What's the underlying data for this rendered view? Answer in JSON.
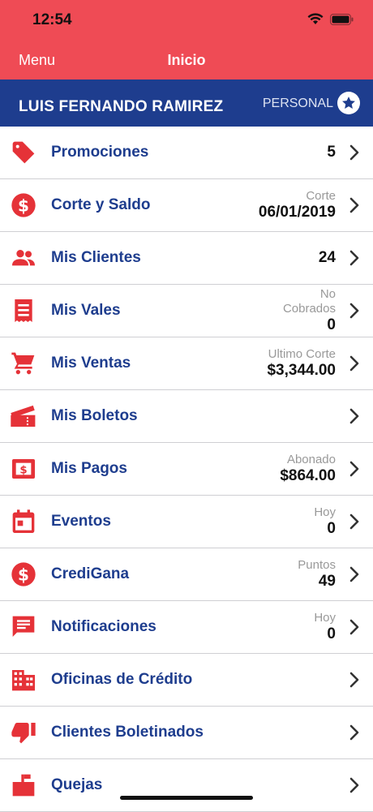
{
  "status": {
    "time": "12:54"
  },
  "nav": {
    "left_label": "Menu",
    "title": "Inicio"
  },
  "user": {
    "name": "LUIS FERNANDO RAMIREZ",
    "type": "PERSONAL"
  },
  "colors": {
    "accent_red": "#EF4B55",
    "brand_blue": "#1E3D8E",
    "icon_red": "#E53238"
  },
  "menu": [
    {
      "label": "Promociones",
      "caption": "",
      "value": "5",
      "icon": "tag-icon"
    },
    {
      "label": "Corte y Saldo",
      "caption": "Corte",
      "value": "06/01/2019",
      "icon": "dollar-circle-icon"
    },
    {
      "label": "Mis Clientes",
      "caption": "",
      "value": "24",
      "icon": "people-icon"
    },
    {
      "label": "Mis Vales",
      "caption": "No\nCobrados",
      "value": "0",
      "icon": "receipt-icon"
    },
    {
      "label": "Mis Ventas",
      "caption": "Ultimo Corte",
      "value": "$3,344.00",
      "icon": "cart-icon"
    },
    {
      "label": "Mis Boletos",
      "caption": "",
      "value": "",
      "icon": "ticket-icon"
    },
    {
      "label": "Mis Pagos",
      "caption": "Abonado",
      "value": "$864.00",
      "icon": "payment-icon"
    },
    {
      "label": "Eventos",
      "caption": "Hoy",
      "value": "0",
      "icon": "calendar-icon"
    },
    {
      "label": "CrediGana",
      "caption": "Puntos",
      "value": "49",
      "icon": "dollar-circle-icon"
    },
    {
      "label": "Notificaciones",
      "caption": "Hoy",
      "value": "0",
      "icon": "message-icon"
    },
    {
      "label": "Oficinas de Crédito",
      "caption": "",
      "value": "",
      "icon": "building-icon"
    },
    {
      "label": "Clientes Boletinados",
      "caption": "",
      "value": "",
      "icon": "thumbs-down-icon"
    },
    {
      "label": "Quejas",
      "caption": "",
      "value": "",
      "icon": "mailbox-icon"
    }
  ]
}
